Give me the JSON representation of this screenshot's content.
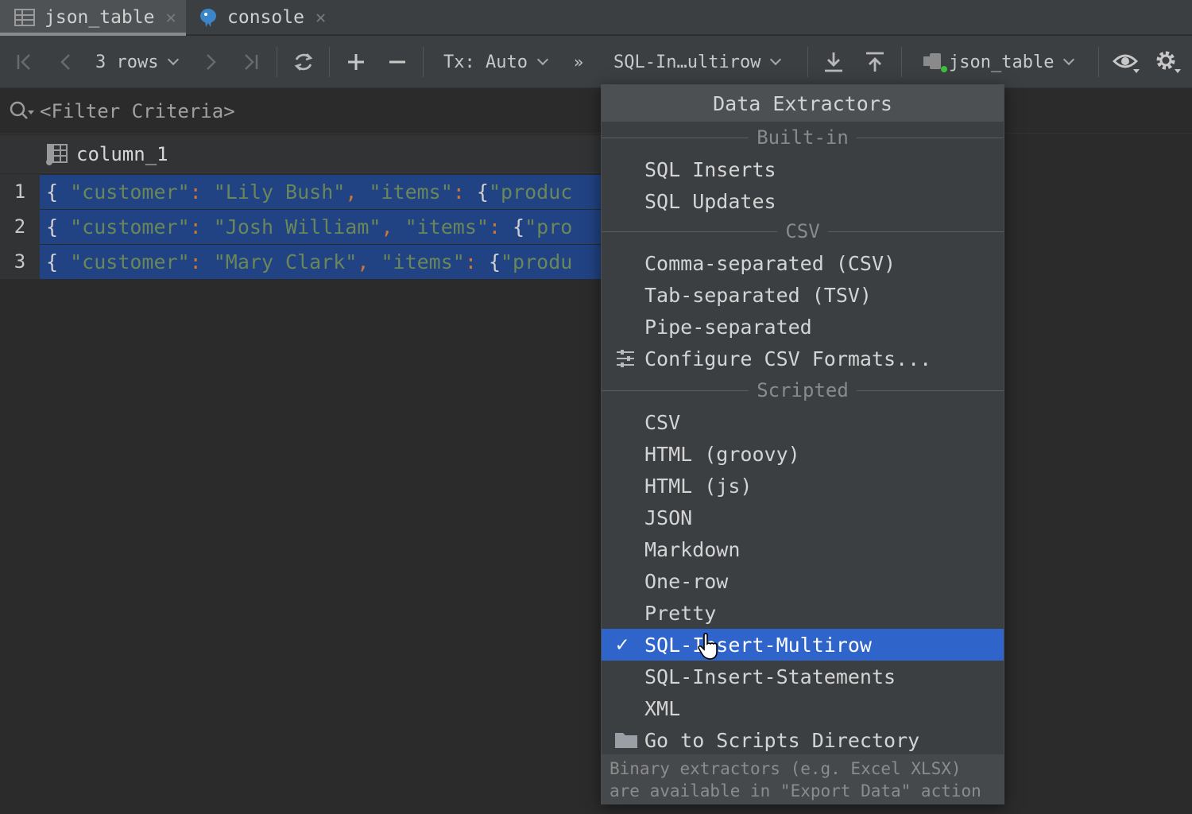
{
  "tabs": [
    {
      "label": "json_table",
      "icon": "table-icon",
      "active": true
    },
    {
      "label": "console",
      "icon": "postgresql-icon",
      "active": false
    }
  ],
  "toolbar": {
    "rows_label": "3 rows",
    "tx_label": "Tx: Auto",
    "extractor_label": "SQL-In…ultirow",
    "datasource_label": "json_table"
  },
  "filter": {
    "placeholder": "<Filter Criteria>"
  },
  "grid": {
    "column_header": "column_1",
    "rows": [
      {
        "num": "1",
        "brace": "{ ",
        "key": "\"customer\"",
        "colon": ": ",
        "value": "\"Lily Bush\"",
        "comma": ", ",
        "key2": "\"items\"",
        "colon2": ": ",
        "rest_brace": "{",
        "rest": "\"produc"
      },
      {
        "num": "2",
        "brace": "{ ",
        "key": "\"customer\"",
        "colon": ": ",
        "value": "\"Josh William\"",
        "comma": ", ",
        "key2": "\"items\"",
        "colon2": ": ",
        "rest_brace": "{",
        "rest": "\"pro"
      },
      {
        "num": "3",
        "brace": "{ ",
        "key": "\"customer\"",
        "colon": ": ",
        "value": "\"Mary Clark\"",
        "comma": ", ",
        "key2": "\"items\"",
        "colon2": ": ",
        "rest_brace": "{",
        "rest": "\"produ"
      }
    ]
  },
  "popup": {
    "title": "Data Extractors",
    "sections": {
      "builtin": "Built-in",
      "csv": "CSV",
      "scripted": "Scripted"
    },
    "builtin_items": [
      "SQL Inserts",
      "SQL Updates"
    ],
    "csv_items": [
      "Comma-separated (CSV)",
      "Tab-separated (TSV)",
      "Pipe-separated",
      "Configure CSV Formats..."
    ],
    "scripted_items": [
      "CSV",
      "HTML (groovy)",
      "HTML (js)",
      "JSON",
      "Markdown",
      "One-row",
      "Pretty",
      "SQL-Insert-Multirow",
      "SQL-Insert-Statements",
      "XML",
      "Go to Scripts Directory"
    ],
    "selected_item": "SQL-Insert-Multirow",
    "check_mark": "✓",
    "footer_line1": "Binary extractors (e.g. Excel XLSX)",
    "footer_line2": "are available in \"Export Data\" action"
  }
}
